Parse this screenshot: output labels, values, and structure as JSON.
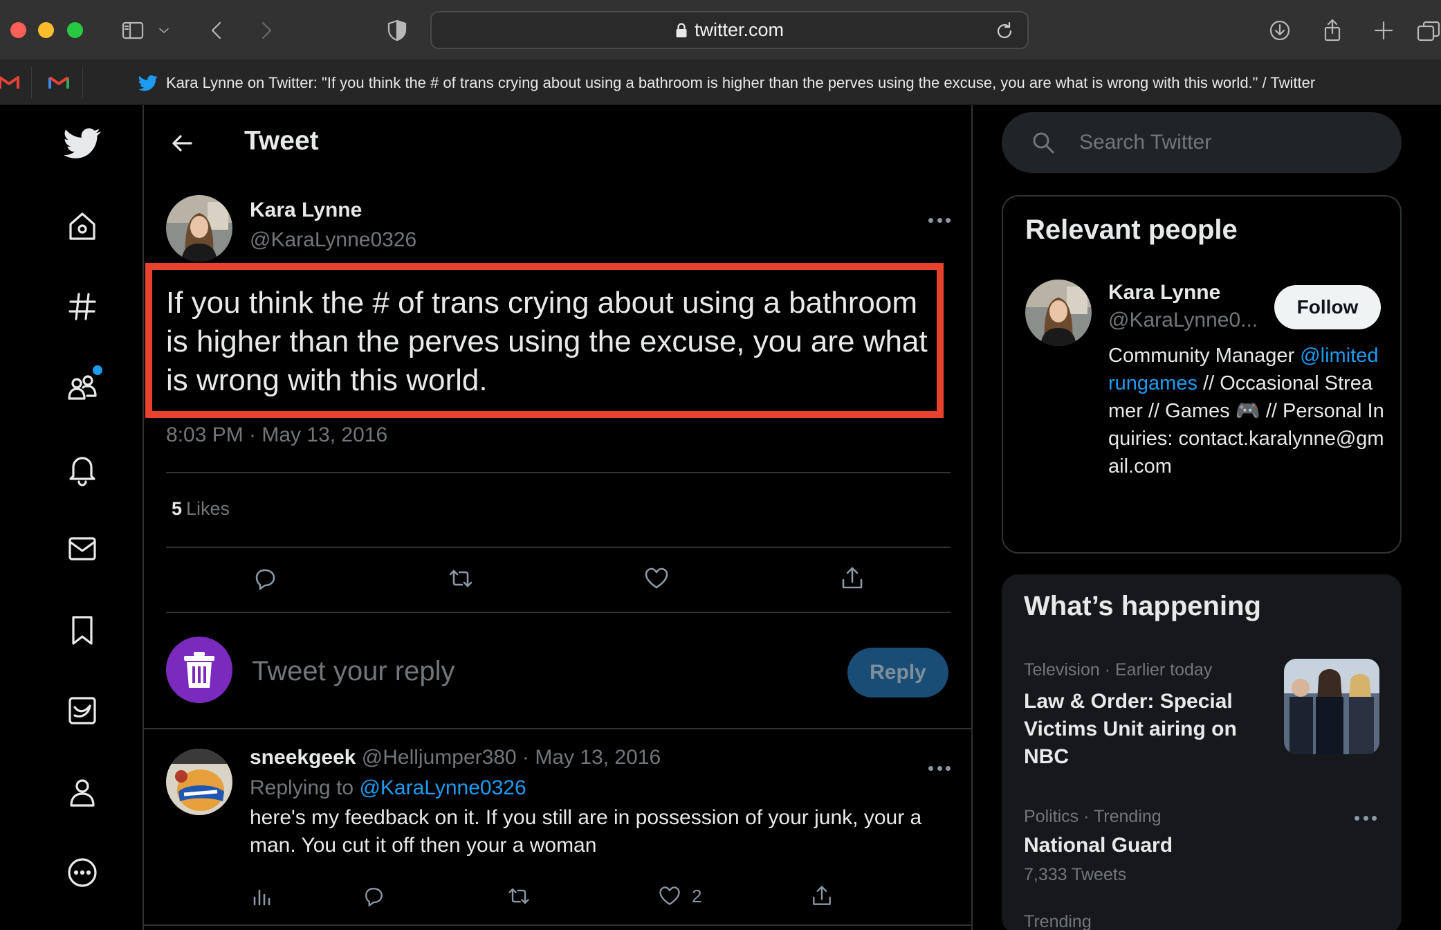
{
  "browser": {
    "url": "twitter.com",
    "tab_title": "Kara Lynne on Twitter: \"If you think the # of trans crying about using a bathroom is higher than the perves using the excuse, you are what is wrong with this world.\" / Twitter"
  },
  "header": {
    "title": "Tweet"
  },
  "tweet": {
    "author_name": "Kara Lynne",
    "author_handle": "@KaraLynne0326",
    "text": "If you think the # of trans crying about using a bathroom is higher than the perves using the excuse, you are what is wrong with this world.",
    "time": "8:03 PM · May 13, 2016",
    "likes_count": "5",
    "likes_label": "Likes"
  },
  "reply_box": {
    "placeholder": "Tweet your reply",
    "button": "Reply"
  },
  "comment": {
    "name": "sneekgeek",
    "meta": "@Helljumper380 · May 13, 2016",
    "replying_prefix": "Replying to",
    "replying_to": "@KaraLynne0326",
    "text": "here's my feedback on it. If you still are in possession of your junk, your a man. You cut it off then your a woman",
    "like_count": "2"
  },
  "search": {
    "placeholder": "Search Twitter"
  },
  "relevant_people": {
    "title": "Relevant people",
    "name": "Kara Lynne",
    "handle": "@KaraLynne0...",
    "follow_label": "Follow",
    "bio_before": "Community Manager ",
    "bio_link": "@limitedrungames",
    "bio_after": " // Occasional Streamer // Games 🎮 // Personal Inquiries: contact.karalynne@gmail.com"
  },
  "happening": {
    "title": "What’s happening",
    "trends": [
      {
        "category": "Television · Earlier today",
        "title": "Law & Order: Special Victims Unit airing on NBC"
      },
      {
        "category": "Politics · Trending",
        "title": "National Guard",
        "count": "7,333 Tweets"
      },
      {
        "category": "Trending"
      }
    ]
  },
  "colors": {
    "accent": "#1d9bf0",
    "highlight_box": "#e8412d",
    "reply_avatar": "#7a2bbd",
    "background": "#000000"
  }
}
